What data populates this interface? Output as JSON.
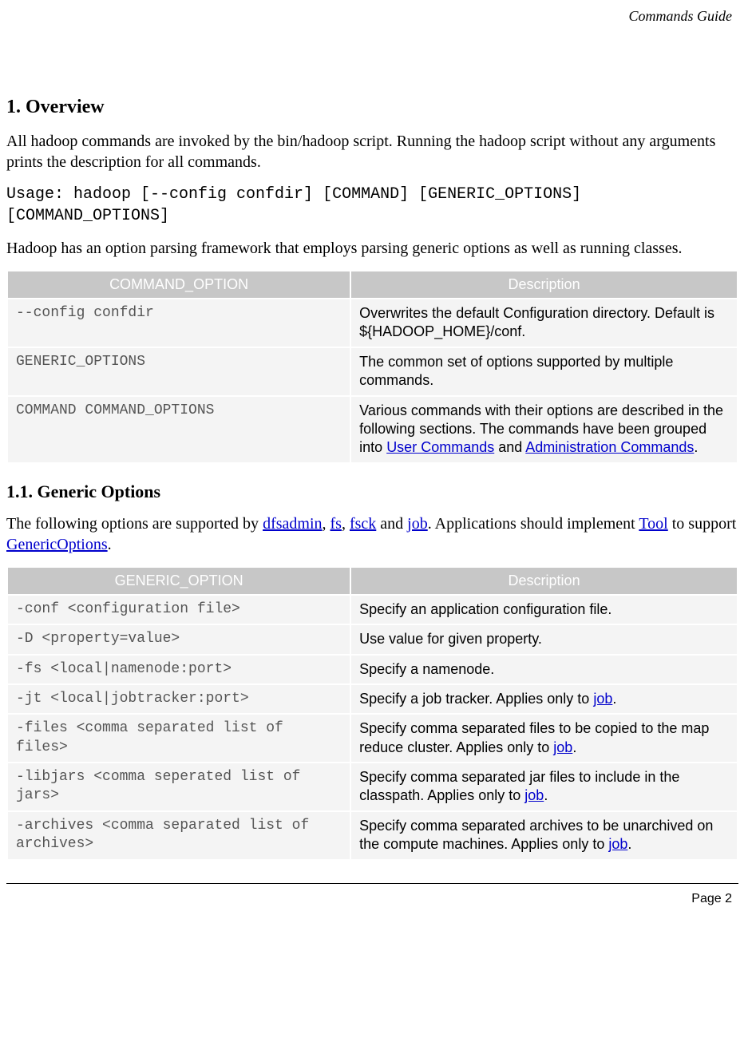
{
  "header": {
    "doc_title": "Commands Guide"
  },
  "section1": {
    "heading": "1. Overview",
    "p1": "All hadoop commands are invoked by the bin/hadoop script. Running the hadoop script without any arguments prints the description for all commands.",
    "usage": "Usage: hadoop [--config confdir] [COMMAND] [GENERIC_OPTIONS] [COMMAND_OPTIONS]",
    "p2": "Hadoop has an option parsing framework that employs parsing generic options as well as running classes."
  },
  "table1": {
    "head": {
      "c1": "COMMAND_OPTION",
      "c2": "Description"
    },
    "rows": [
      {
        "opt": "--config confdir",
        "desc": "Overwrites the default Configuration directory. Default is ${HADOOP_HOME}/conf."
      },
      {
        "opt": "GENERIC_OPTIONS",
        "desc": "The common set of options supported by multiple commands."
      },
      {
        "opt": "COMMAND COMMAND_OPTIONS",
        "desc_pre": "Various commands with their options are described in the following sections. The commands have been grouped into ",
        "link1": "User Commands",
        "mid": " and ",
        "link2": "Administration Commands",
        "after": "."
      }
    ]
  },
  "section11": {
    "heading": "1.1. Generic Options",
    "p_pre": "The following options are supported by ",
    "l1": "dfsadmin",
    "s1": ", ",
    "l2": "fs",
    "s2": ", ",
    "l3": "fsck",
    "s3": " and ",
    "l4": "job",
    "p_mid": ". Applications should implement ",
    "l5": "Tool",
    "p_mid2": " to support ",
    "l6": "GenericOptions",
    "p_after": "."
  },
  "table2": {
    "head": {
      "c1": "GENERIC_OPTION",
      "c2": "Description"
    },
    "rows": [
      {
        "opt": "-conf <configuration file>",
        "desc": "Specify an application configuration file."
      },
      {
        "opt": "-D <property=value>",
        "desc": "Use value for given property."
      },
      {
        "opt": "-fs <local|namenode:port>",
        "desc": "Specify a namenode."
      },
      {
        "opt": "-jt <local|jobtracker:port>",
        "desc_pre": "Specify a job tracker. Applies only to ",
        "link": "job",
        "after": "."
      },
      {
        "opt": "-files <comma separated list of files>",
        "desc_pre": "Specify comma separated files to be copied to the map reduce cluster. Applies only to ",
        "link": "job",
        "after": "."
      },
      {
        "opt": "-libjars <comma seperated list of jars>",
        "desc_pre": "Specify comma separated jar files to include in the classpath. Applies only to ",
        "link": "job",
        "after": "."
      },
      {
        "opt": "-archives <comma separated list of archives>",
        "desc_pre": "Specify comma separated archives to be unarchived on the compute machines. Applies only to ",
        "link": "job",
        "after": "."
      }
    ]
  },
  "footer": {
    "page": "Page 2"
  }
}
